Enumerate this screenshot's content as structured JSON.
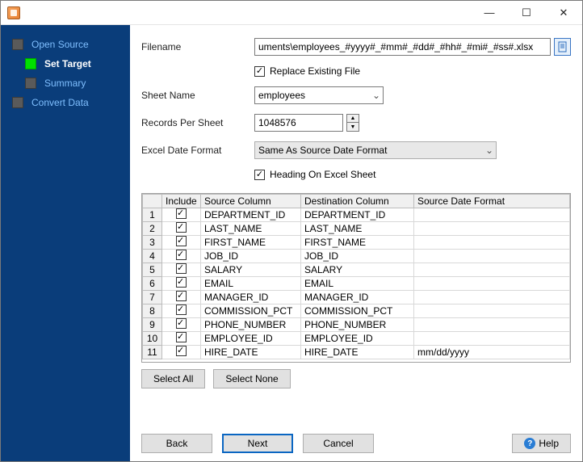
{
  "titlebar": {
    "min": "—",
    "max": "☐",
    "close": "✕"
  },
  "sidebar": {
    "items": [
      {
        "label": "Open Source",
        "active": false,
        "level": 1,
        "box": "off"
      },
      {
        "label": "Set Target",
        "active": true,
        "level": 2,
        "box": "on"
      },
      {
        "label": "Summary",
        "active": false,
        "level": 2,
        "box": "off"
      },
      {
        "label": "Convert Data",
        "active": false,
        "level": 1,
        "box": "off"
      }
    ]
  },
  "form": {
    "filename_label": "Filename",
    "filename_value": "uments\\employees_#yyyy#_#mm#_#dd#_#hh#_#mi#_#ss#.xlsx",
    "replace_label": "Replace Existing File",
    "sheet_label": "Sheet Name",
    "sheet_value": "employees",
    "records_label": "Records Per Sheet",
    "records_value": "1048576",
    "dateformat_label": "Excel Date Format",
    "dateformat_value": "Same As Source Date Format",
    "heading_label": "Heading On Excel Sheet"
  },
  "grid": {
    "headers": {
      "include": "Include",
      "source": "Source Column",
      "dest": "Destination Column",
      "srcdate": "Source Date Format"
    },
    "rows": [
      {
        "n": "1",
        "inc": true,
        "src": "DEPARTMENT_ID",
        "dst": "DEPARTMENT_ID",
        "fmt": ""
      },
      {
        "n": "2",
        "inc": true,
        "src": "LAST_NAME",
        "dst": "LAST_NAME",
        "fmt": ""
      },
      {
        "n": "3",
        "inc": true,
        "src": "FIRST_NAME",
        "dst": "FIRST_NAME",
        "fmt": ""
      },
      {
        "n": "4",
        "inc": true,
        "src": "JOB_ID",
        "dst": "JOB_ID",
        "fmt": ""
      },
      {
        "n": "5",
        "inc": true,
        "src": "SALARY",
        "dst": "SALARY",
        "fmt": ""
      },
      {
        "n": "6",
        "inc": true,
        "src": "EMAIL",
        "dst": "EMAIL",
        "fmt": ""
      },
      {
        "n": "7",
        "inc": true,
        "src": "MANAGER_ID",
        "dst": "MANAGER_ID",
        "fmt": ""
      },
      {
        "n": "8",
        "inc": true,
        "src": "COMMISSION_PCT",
        "dst": "COMMISSION_PCT",
        "fmt": ""
      },
      {
        "n": "9",
        "inc": true,
        "src": "PHONE_NUMBER",
        "dst": "PHONE_NUMBER",
        "fmt": ""
      },
      {
        "n": "10",
        "inc": true,
        "src": "EMPLOYEE_ID",
        "dst": "EMPLOYEE_ID",
        "fmt": ""
      },
      {
        "n": "11",
        "inc": true,
        "src": "HIRE_DATE",
        "dst": "HIRE_DATE",
        "fmt": "mm/dd/yyyy"
      }
    ],
    "select_all": "Select All",
    "select_none": "Select None"
  },
  "wizard": {
    "back": "Back",
    "next": "Next",
    "cancel": "Cancel",
    "help": "Help"
  }
}
